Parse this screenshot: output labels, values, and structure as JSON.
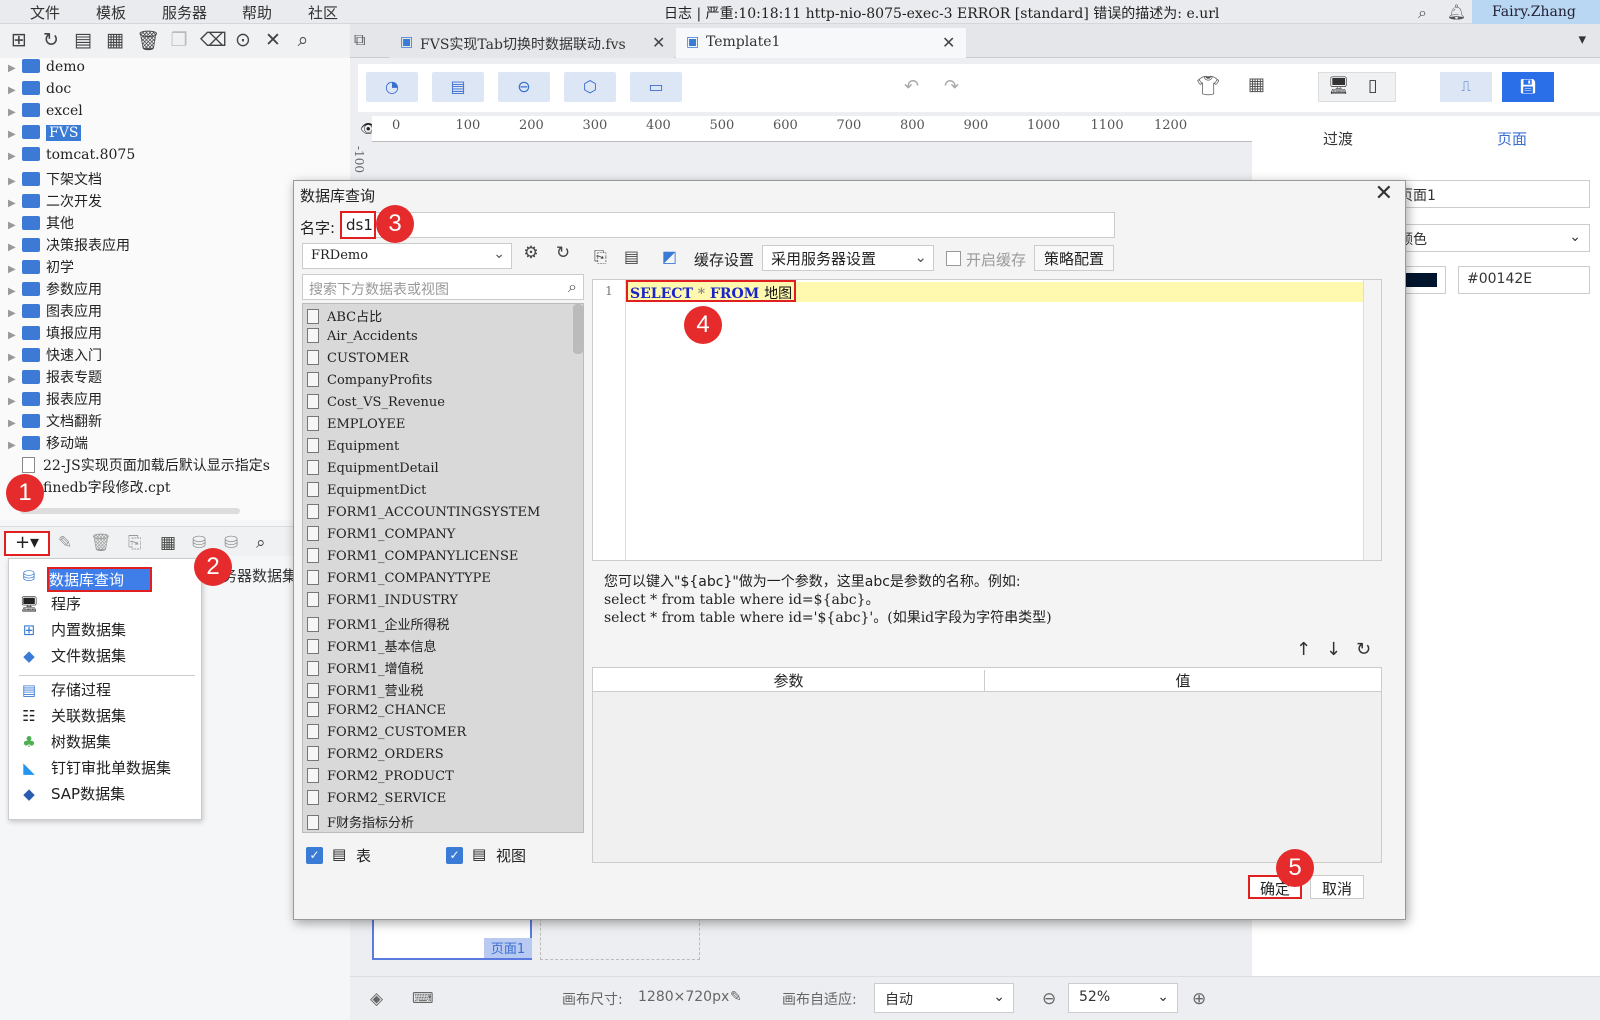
{
  "menubar": {
    "items": [
      "文件",
      "模板",
      "服务器",
      "帮助",
      "社区"
    ]
  },
  "log_line": "日志 | 严重:10:18:11 http-nio-8075-exec-3 ERROR [standard] 错误的描述为: e.url",
  "user": "Fairy.Zhang",
  "tree": {
    "items": [
      {
        "label": "demo",
        "type": "folder"
      },
      {
        "label": "doc",
        "type": "folder"
      },
      {
        "label": "excel",
        "type": "folder"
      },
      {
        "label": "FVS",
        "type": "folder",
        "selected": true
      },
      {
        "label": "tomcat.8075",
        "type": "folder"
      },
      {
        "label": "下架文档",
        "type": "folder"
      },
      {
        "label": "二次开发",
        "type": "folder"
      },
      {
        "label": "其他",
        "type": "folder"
      },
      {
        "label": "决策报表应用",
        "type": "folder"
      },
      {
        "label": "初学",
        "type": "folder"
      },
      {
        "label": "参数应用",
        "type": "folder"
      },
      {
        "label": "图表应用",
        "type": "folder"
      },
      {
        "label": "填报应用",
        "type": "folder"
      },
      {
        "label": "快速入门",
        "type": "folder"
      },
      {
        "label": "报表专题",
        "type": "folder"
      },
      {
        "label": "报表应用",
        "type": "folder"
      },
      {
        "label": "文档翻新",
        "type": "folder"
      },
      {
        "label": "移动端",
        "type": "folder"
      },
      {
        "label": "22-JS实现页面加载后默认显示指定s",
        "type": "file"
      },
      {
        "label": "finedb字段修改.cpt",
        "type": "file"
      }
    ]
  },
  "dataset_menu": {
    "add_button": "+▾",
    "items": [
      {
        "label": "数据库查询",
        "icon": "database-icon"
      },
      {
        "label": "程序",
        "icon": "program-icon"
      },
      {
        "label": "内置数据集",
        "icon": "builtin-icon"
      },
      {
        "label": "文件数据集",
        "icon": "file-dataset-icon"
      },
      {
        "label": "存储过程",
        "icon": "procedure-icon"
      },
      {
        "label": "关联数据集",
        "icon": "relation-icon"
      },
      {
        "label": "树数据集",
        "icon": "tree-icon"
      },
      {
        "label": "钉钉审批单数据集",
        "icon": "dingtalk-icon"
      },
      {
        "label": "SAP数据集",
        "icon": "sap-icon"
      }
    ],
    "behind_text": "务器数据集"
  },
  "tabs": [
    {
      "label": "FVS实现Tab切换时数据联动.fvs"
    },
    {
      "label": "Template1"
    }
  ],
  "ruler": [
    "0",
    "100",
    "200",
    "300",
    "400",
    "500",
    "600",
    "700",
    "800",
    "900",
    "1000",
    "1100",
    "1200"
  ],
  "ruler_v": "-100",
  "right_panel": {
    "tab_transition": "过渡",
    "tab_page": "页面",
    "page_name": "页面1",
    "color_mode": "颜色",
    "color_hex": "#00142E"
  },
  "canvas": {
    "page_label": "页面1"
  },
  "statusbar": {
    "size_label": "画布尺寸:",
    "size_value": "1280×720px",
    "adapt_label": "画布自适应:",
    "adapt_value": "自动",
    "zoom": "52%"
  },
  "dialog": {
    "title": "数据库查询",
    "name_label": "名字:",
    "name_value": "ds1",
    "db_select": "FRDemo",
    "search_placeholder": "搜索下方数据表或视图",
    "tables": [
      "ABC占比",
      "Air_Accidents",
      "CUSTOMER",
      "CompanyProfits",
      "Cost_VS_Revenue",
      "EMPLOYEE",
      "Equipment",
      "EquipmentDetail",
      "EquipmentDict",
      "FORM1_ACCOUNTINGSYSTEM",
      "FORM1_COMPANY",
      "FORM1_COMPANYLICENSE",
      "FORM1_COMPANYTYPE",
      "FORM1_INDUSTRY",
      "FORM1_企业所得税",
      "FORM1_基本信息",
      "FORM1_增值税",
      "FORM1_营业税",
      "FORM2_CHANCE",
      "FORM2_CUSTOMER",
      "FORM2_ORDERS",
      "FORM2_PRODUCT",
      "FORM2_SERVICE",
      "F财务指标分析"
    ],
    "check_table": "表",
    "check_view": "视图",
    "cache_label": "缓存设置",
    "cache_value": "采用服务器设置",
    "cache_enable": "开启缓存",
    "policy_button": "策略配置",
    "line_no": "1",
    "sql": {
      "select": "SELECT",
      "star": "*",
      "from": "FROM",
      "table": "地图"
    },
    "hint_lines": [
      "您可以键入\"${abc}\"做为一个参数，这里abc是参数的名称。例如:",
      "select * from table where id=${abc}。",
      "select * from table where id='${abc}'。(如果id字段为字符串类型)"
    ],
    "param_col": "参数",
    "value_col": "值",
    "ok": "确定",
    "cancel": "取消"
  },
  "badges": [
    "1",
    "2",
    "3",
    "4",
    "5"
  ]
}
